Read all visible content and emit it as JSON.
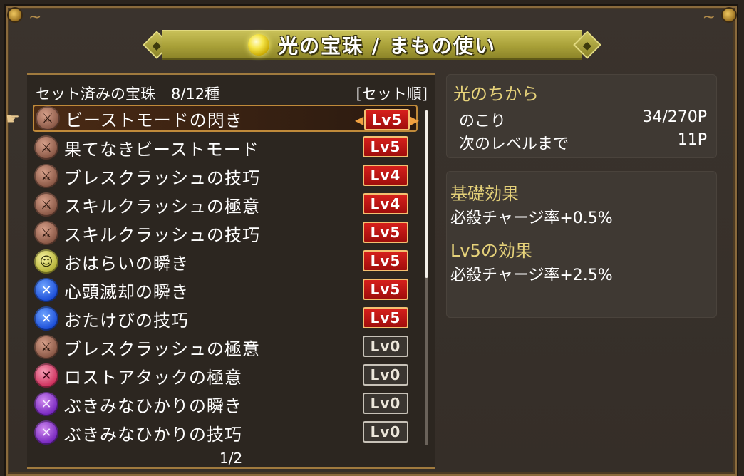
{
  "banner": {
    "title": "光の宝珠 / まもの使い",
    "cap_icon": "◆"
  },
  "list": {
    "header_label": "セット済みの宝珠",
    "count": "8/12種",
    "sort": "[セット順]",
    "page": "1/2",
    "items": [
      {
        "label": "ビーストモードの閃き",
        "level": "Lv5",
        "active": true,
        "gem": "brown",
        "glyph": "⚔"
      },
      {
        "label": "果てなきビーストモード",
        "level": "Lv5",
        "active": true,
        "gem": "brown",
        "glyph": "⚔"
      },
      {
        "label": "ブレスクラッシュの技巧",
        "level": "Lv4",
        "active": true,
        "gem": "brown",
        "glyph": "⚔"
      },
      {
        "label": "スキルクラッシュの極意",
        "level": "Lv4",
        "active": true,
        "gem": "brown",
        "glyph": "⚔"
      },
      {
        "label": "スキルクラッシュの技巧",
        "level": "Lv5",
        "active": true,
        "gem": "brown",
        "glyph": "⚔"
      },
      {
        "label": "おはらいの瞬き",
        "level": "Lv5",
        "active": true,
        "gem": "yellow",
        "glyph": "☺"
      },
      {
        "label": "心頭滅却の瞬き",
        "level": "Lv5",
        "active": true,
        "gem": "blue",
        "glyph": "✕"
      },
      {
        "label": "おたけびの技巧",
        "level": "Lv5",
        "active": true,
        "gem": "blue",
        "glyph": "✕"
      },
      {
        "label": "ブレスクラッシュの極意",
        "level": "Lv0",
        "active": false,
        "gem": "brown",
        "glyph": "⚔"
      },
      {
        "label": "ロストアタックの極意",
        "level": "Lv0",
        "active": false,
        "gem": "pink",
        "glyph": "✕"
      },
      {
        "label": "ぶきみなひかりの瞬き",
        "level": "Lv0",
        "active": false,
        "gem": "purple",
        "glyph": "✕"
      },
      {
        "label": "ぶきみなひかりの技巧",
        "level": "Lv0",
        "active": false,
        "gem": "purple",
        "glyph": "✕"
      }
    ]
  },
  "power": {
    "title": "光のちから",
    "remaining_label": "のこり",
    "remaining_value": "34/270P",
    "next_label": "次のレベルまで",
    "next_value": "11P"
  },
  "effects": {
    "base_title": "基礎効果",
    "base_text": "必殺チャージ率+0.5%",
    "lv_title": "Lv5の効果",
    "lv_text": "必殺チャージ率+2.5%"
  },
  "colors": {
    "banner": "#b0a840",
    "level_on": "#c0140f",
    "accent_gold": "#e6d27a",
    "frame": "#8a6a3c"
  }
}
